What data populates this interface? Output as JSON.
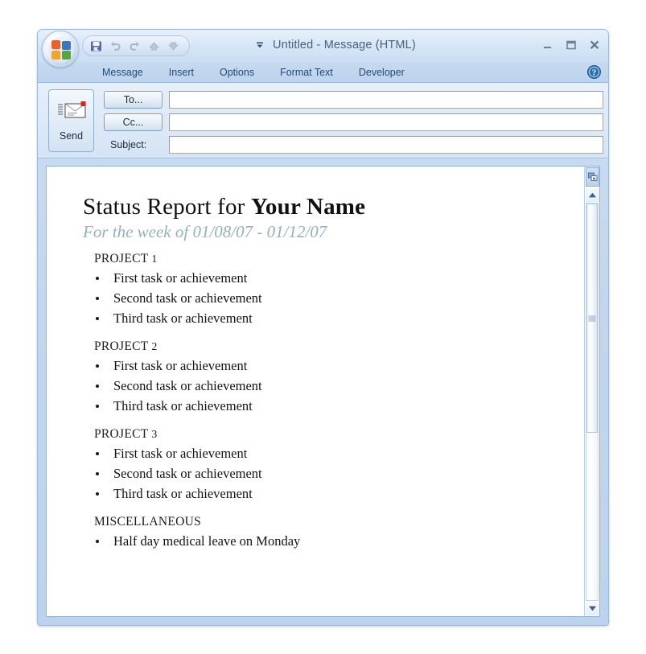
{
  "window": {
    "title": "Untitled  -  Message (HTML)",
    "controls": {
      "minimize": "minimize-button",
      "maximize": "maximize-button",
      "close": "close-button"
    }
  },
  "office_button": {
    "name": "office-orb-button",
    "colors": [
      "#e8622a",
      "#3878c4",
      "#f0a42a",
      "#57a83c"
    ]
  },
  "quick_access_toolbar": {
    "items": [
      {
        "icon": "save-icon",
        "label": "Save",
        "enabled": true
      },
      {
        "icon": "undo-icon",
        "label": "Undo",
        "enabled": false
      },
      {
        "icon": "redo-icon",
        "label": "Redo",
        "enabled": false
      },
      {
        "icon": "previous-item-icon",
        "label": "Previous Item",
        "enabled": false
      },
      {
        "icon": "next-item-icon",
        "label": "Next Item",
        "enabled": false
      }
    ],
    "customize": {
      "icon": "chevron-down-icon",
      "label": "Customize Quick Access Toolbar"
    }
  },
  "ribbon": {
    "tabs": [
      {
        "label": "Message",
        "active": true
      },
      {
        "label": "Insert",
        "active": false
      },
      {
        "label": "Options",
        "active": false
      },
      {
        "label": "Format Text",
        "active": false
      },
      {
        "label": "Developer",
        "active": false
      }
    ],
    "help": {
      "icon": "help-icon",
      "label": "Help"
    }
  },
  "compose": {
    "send": {
      "label": "Send",
      "icon": "send-envelope-icon"
    },
    "fields": [
      {
        "kind": "button",
        "label": "To...",
        "value": "",
        "placeholder": ""
      },
      {
        "kind": "button",
        "label": "Cc...",
        "value": "",
        "placeholder": ""
      },
      {
        "kind": "label",
        "label": "Subject:",
        "value": "",
        "placeholder": ""
      }
    ]
  },
  "document": {
    "title_plain": "Status Report for ",
    "title_bold": "Your Name",
    "subtitle": "For the week of 01/08/07 - 01/12/07",
    "sections": [
      {
        "heading": "PROJECT",
        "number": "1",
        "items": [
          "First task or achievement",
          "Second task or achievement",
          "Third task or achievement"
        ]
      },
      {
        "heading": "PROJECT",
        "number": "2",
        "items": [
          "First task or achievement",
          "Second task or achievement",
          "Third task or achievement"
        ]
      },
      {
        "heading": "PROJECT",
        "number": "3",
        "items": [
          "First task or achievement",
          "Second task or achievement",
          "Third task or achievement"
        ]
      },
      {
        "heading": "MISCELLANEOUS",
        "number": "",
        "items": [
          "Half day medical leave on Monday"
        ]
      }
    ]
  },
  "scrollbar": {
    "top_icon": "select-browse-object-icon",
    "up_arrow": "scroll-up-arrow-icon",
    "down_arrow": "scroll-down-arrow-icon",
    "thumb": "scroll-thumb",
    "position_percent": 0
  },
  "colors": {
    "frame": "#bcd3ed",
    "titlebar_text": "#46637f",
    "tab_text": "#1f4b73",
    "doc_title": "#10100f",
    "doc_subtitle": "#93b2ba",
    "body_text": "#121210"
  }
}
